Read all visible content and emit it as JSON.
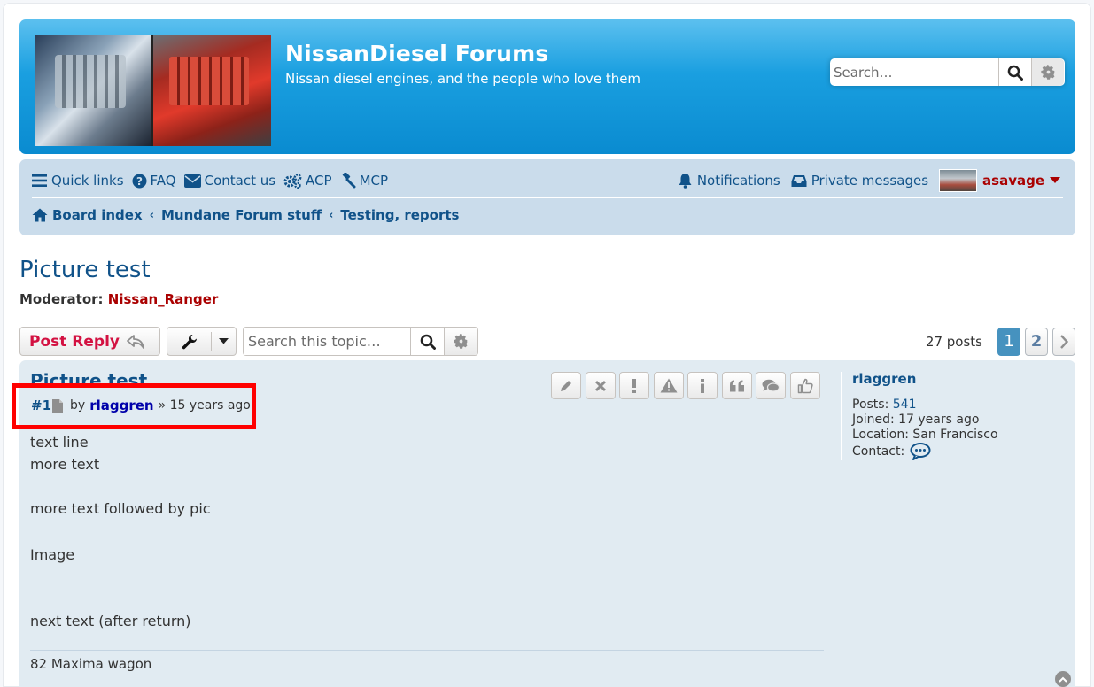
{
  "site": {
    "title": "NissanDiesel Forums",
    "description": "Nissan diesel engines, and the people who love them",
    "search_placeholder": "Search…"
  },
  "nav": {
    "quick_links": "Quick links",
    "faq": "FAQ",
    "contact": "Contact us",
    "acp": "ACP",
    "mcp": "MCP",
    "notifications": "Notifications",
    "private_messages": "Private messages",
    "username": "asavage"
  },
  "breadcrumbs": [
    "Board index",
    "Mundane Forum stuff",
    "Testing, reports"
  ],
  "topic": {
    "title": "Picture test",
    "moderator_label": "Moderator:",
    "moderator_name": "Nissan_Ranger"
  },
  "actions": {
    "post_reply": "Post Reply",
    "search_placeholder": "Search this topic…"
  },
  "pagination": {
    "posts_count": "27 posts",
    "pages": [
      "1",
      "2"
    ],
    "current": "1"
  },
  "post": {
    "title": "Picture test",
    "number": "#1",
    "by": "by",
    "author": "rlaggren",
    "time": "» 15 years ago",
    "lines": [
      "text line",
      "more text",
      "more text followed by pic",
      "Image",
      "next text (after return)"
    ],
    "signature": "82 Maxima wagon"
  },
  "profile": {
    "name": "rlaggren",
    "posts_label": "Posts:",
    "posts_value": "541",
    "joined": "Joined: 17 years ago",
    "location": "Location: San Francisco",
    "contact_label": "Contact:"
  },
  "colors": {
    "accent": "#105289",
    "header_blue": "#12A3EB",
    "nav_bg": "#cadceb",
    "post_bg": "#e1ebf2",
    "reply_red": "#d31141",
    "user_red": "#AA0000",
    "highlight": "#ff0000"
  }
}
